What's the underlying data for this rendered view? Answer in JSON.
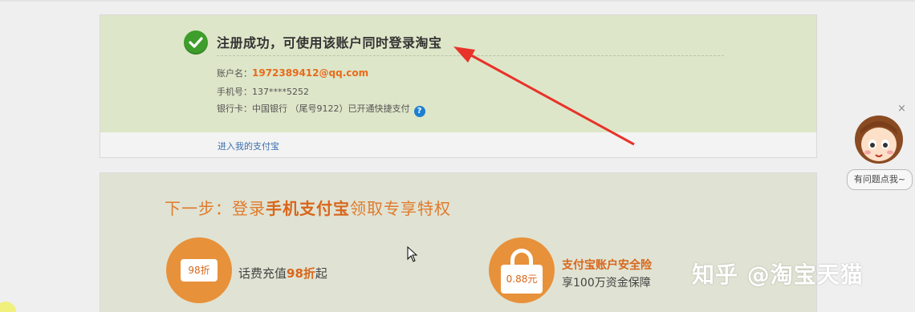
{
  "success": {
    "title": "注册成功，可使用该账户同时登录淘宝",
    "account_label": "账户名：",
    "account_value": "1972389412@qq.com",
    "phone_label": "手机号：",
    "phone_value": "137****5252",
    "bank_label": "银行卡：",
    "bank_value": "中国银行 （尾号9122）已开通快捷支付",
    "help_glyph": "?",
    "enter_link": "进入我的支付宝"
  },
  "next": {
    "title_prefix": "下一步：登录",
    "title_strong": "手机支付宝",
    "title_suffix": "领取专享特权",
    "benefit1": {
      "icon_text": "98折",
      "text_prefix": "话费充值",
      "text_num": "98折",
      "text_suffix": "起"
    },
    "benefit2": {
      "icon_text": "0.88元",
      "title": "支付宝账户安全险",
      "subtitle": "享100万资金保障"
    }
  },
  "helper": {
    "close": "×",
    "bubble": "有问题点我~"
  },
  "watermark": "知乎 @淘宝天猫",
  "colors": {
    "success_bg": "#dde6c8",
    "next_bg": "#e0e3d3",
    "accent_orange": "#e8913b",
    "link_blue": "#3a6fae",
    "check_green": "#3f9d2b",
    "arrow_red": "#e8322a"
  }
}
